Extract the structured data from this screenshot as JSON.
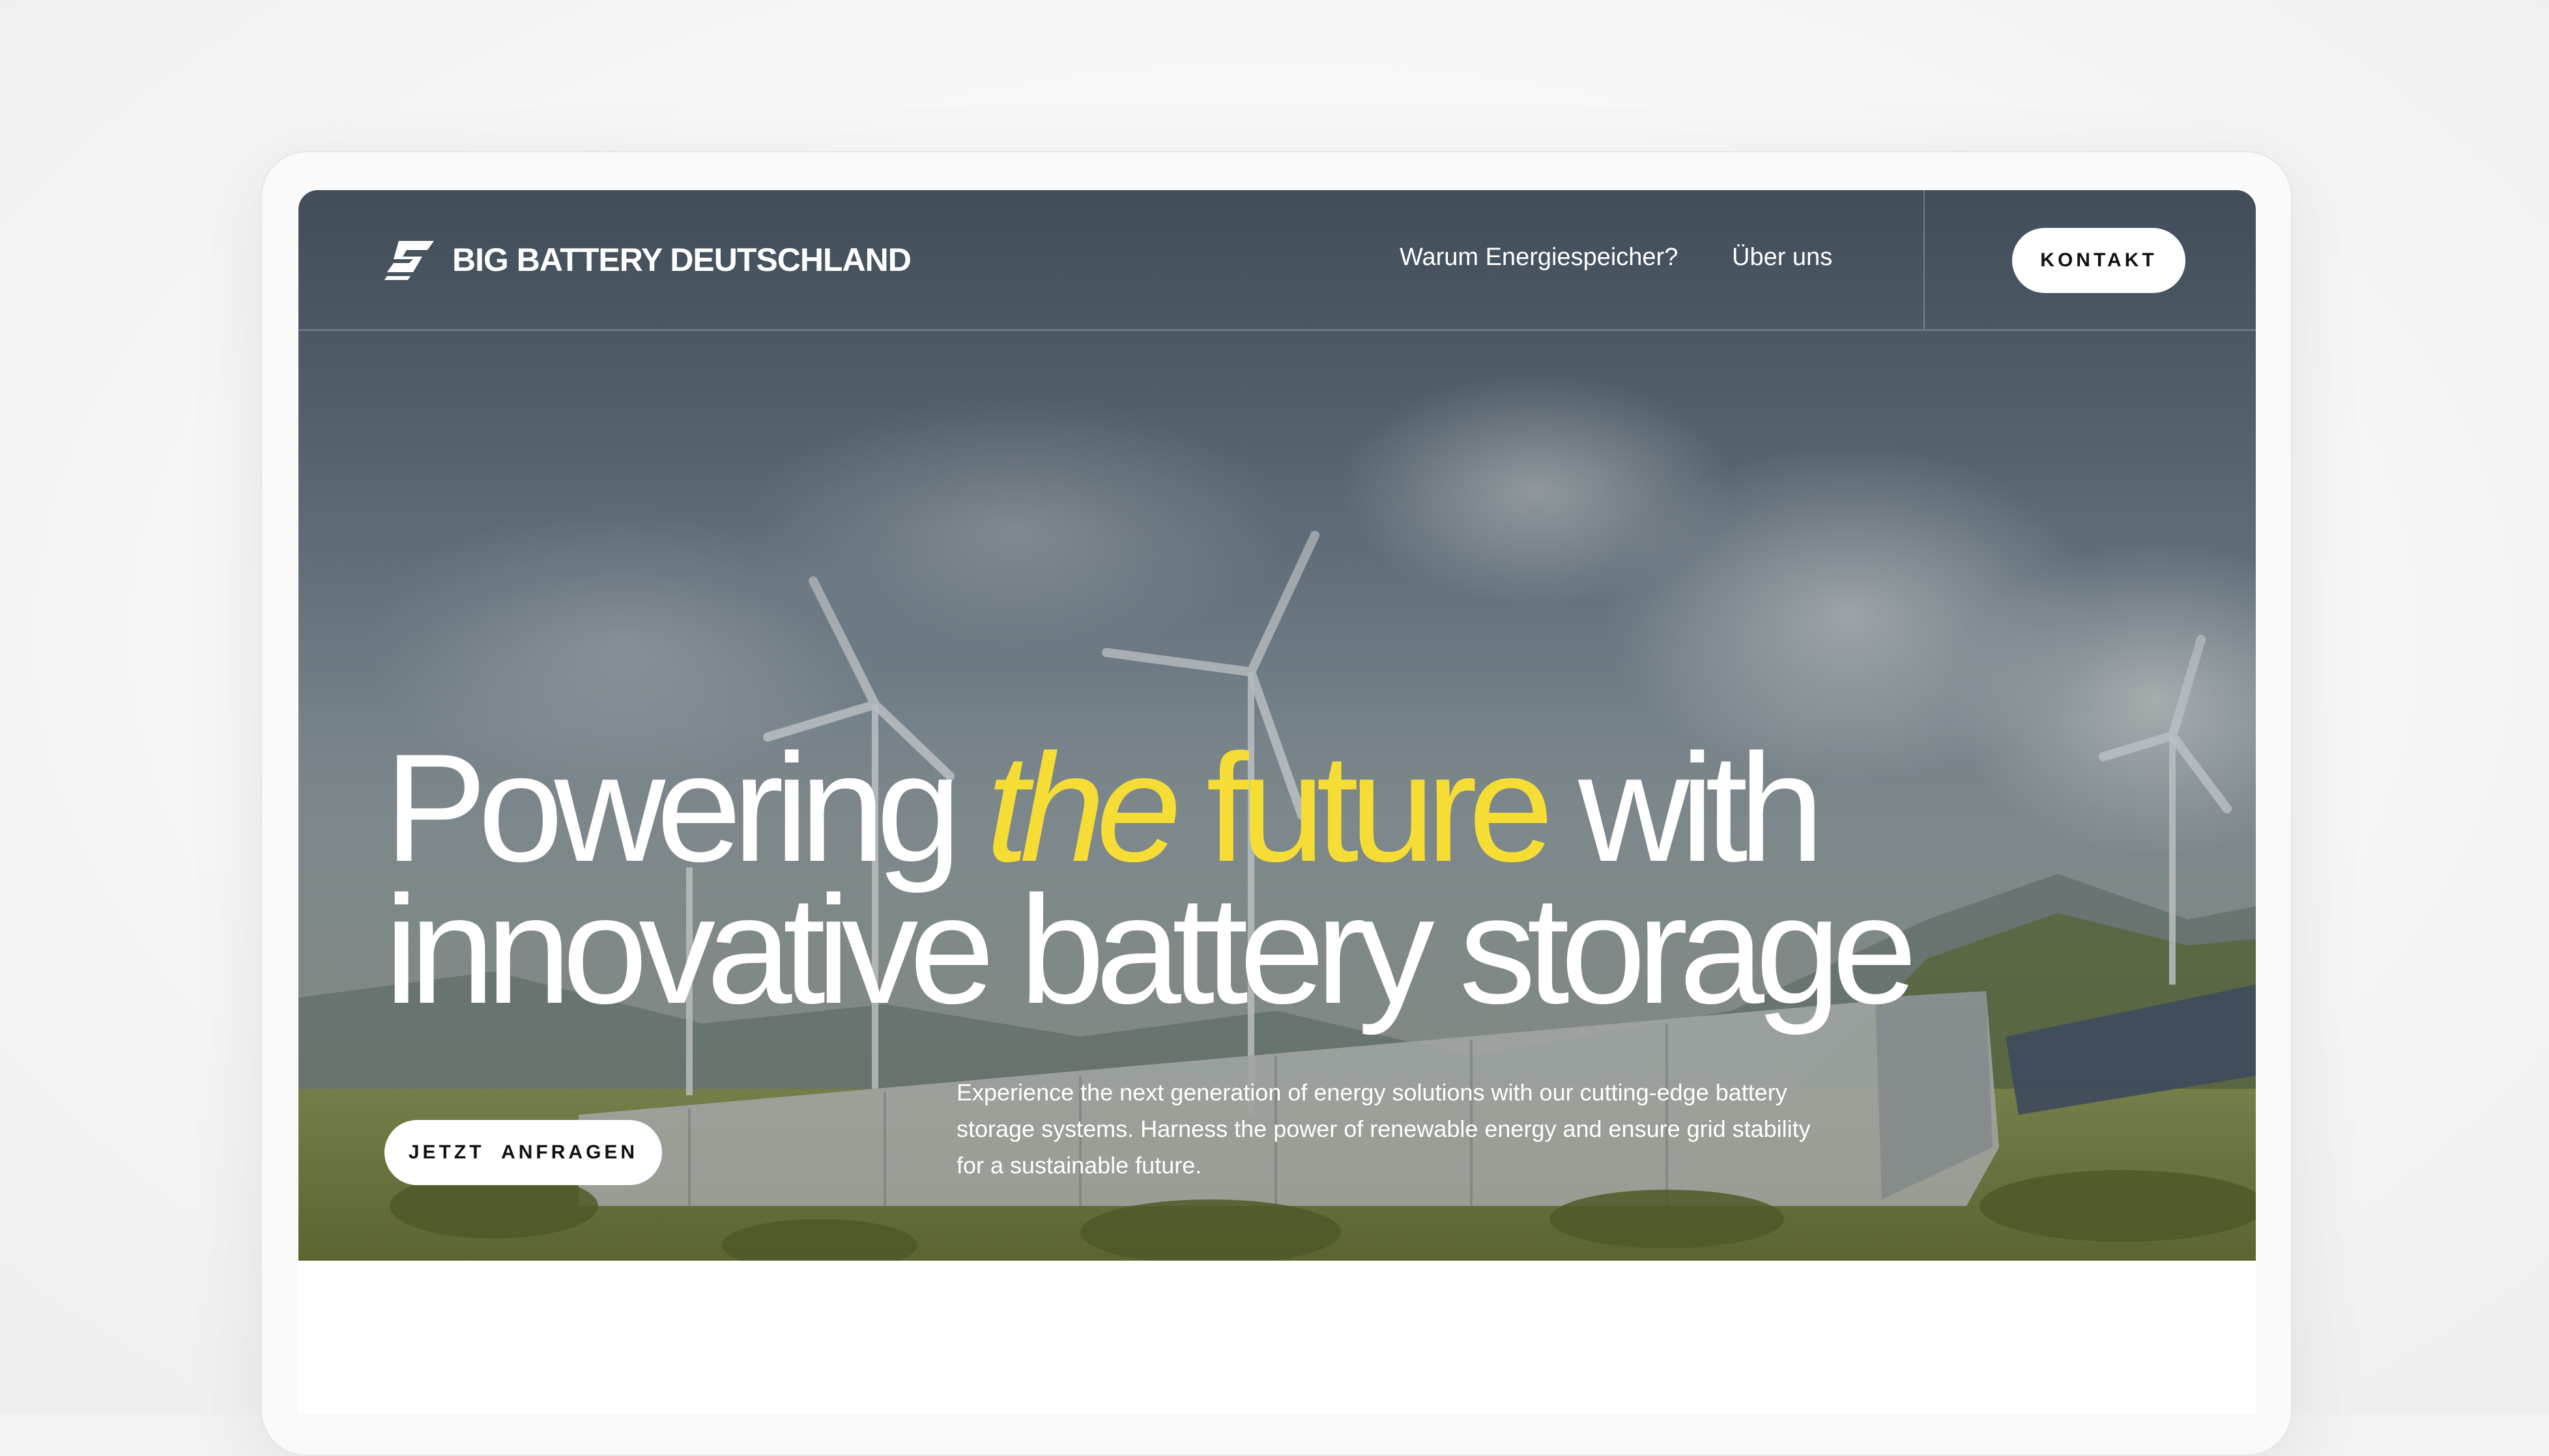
{
  "brand": {
    "name": "BIG BATTERY DEUTSCHLAND",
    "logo_icon": "lightning-s-icon"
  },
  "nav": {
    "links": [
      "Warum Energiespeicher?",
      "Über uns"
    ],
    "contact_button": "KONTAKT"
  },
  "hero": {
    "headline": {
      "part1": "Powering ",
      "accent_italic": "the",
      "accent_rest": " future",
      "part2": " with",
      "line2": "innovative battery storage"
    },
    "cta_button": "JETZT  ANFRAGEN",
    "description": "Experience the next generation of energy solutions with our cutting-edge battery storage systems. Harness the power of renewable energy and ensure grid stability for a sustainable future.",
    "background_image": "wind turbines, battery storage containers and solar panels in green meadow"
  },
  "colors": {
    "accent": "#f5dd36",
    "text_on_image": "#ffffff",
    "button_bg": "#ffffff",
    "button_text": "#111111"
  }
}
